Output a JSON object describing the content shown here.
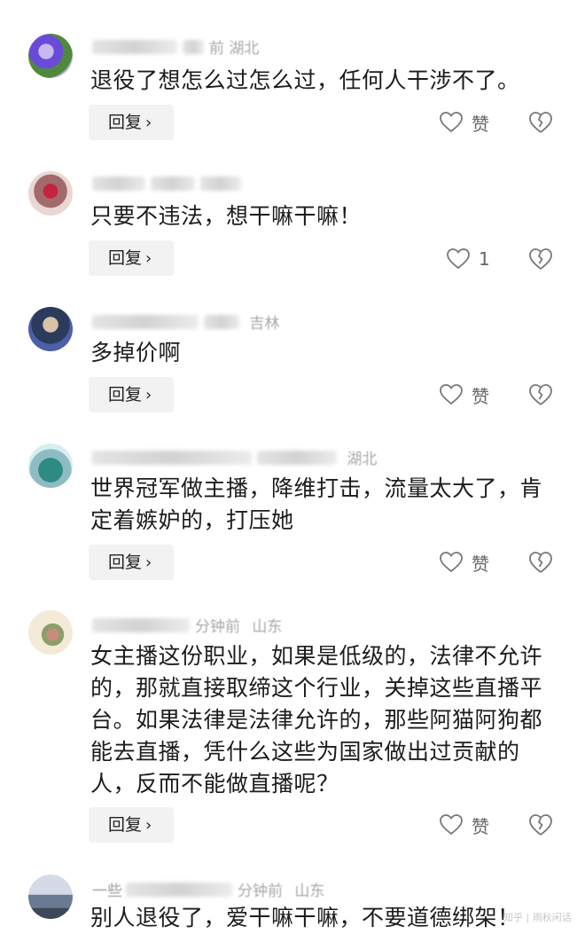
{
  "comments": [
    {
      "user": "",
      "time": "前",
      "region": "湖北",
      "text": "退役了想怎么过怎么过，任何人干涉不了。",
      "reply_label": "回复",
      "like_label": "赞",
      "avatar_colors": [
        "#6a4bd8",
        "#4f8a3c",
        "#c7b8ef"
      ]
    },
    {
      "user": "",
      "time": "",
      "region": "",
      "text": "只要不违法，想干嘛干嘛！",
      "reply_label": "回复",
      "like_label": "1",
      "avatar_colors": [
        "#a36a6d",
        "#c4243d",
        "#e8d7d2"
      ]
    },
    {
      "user": "",
      "time": "",
      "region": "吉林",
      "text": "多掉价啊",
      "reply_label": "回复",
      "like_label": "赞",
      "avatar_colors": [
        "#2c3b5c",
        "#d9c2a8",
        "#4c5fa8"
      ]
    },
    {
      "user": "",
      "time": "",
      "region": "湖北",
      "text": "世界冠军做主播，降维打击，流量太大了，肯定着嫉妒的，打压她",
      "reply_label": "回复",
      "like_label": "赞",
      "avatar_colors": [
        "#8fbcc4",
        "#2e8b83",
        "#d6eef0"
      ]
    },
    {
      "user": "",
      "time": "分钟前",
      "region": "山东",
      "text": "女主播这份职业，如果是低级的，法律不允许的，那就直接取缔这个行业，关掉这些直播平台。如果法律是法律允许的，那些阿猫阿狗都能去直播，凭什么这些为国家做出过贡献的人，反而不能做直播呢？",
      "reply_label": "回复",
      "like_label": "赞",
      "avatar_colors": [
        "#f3ead8",
        "#c78d7a",
        "#8aa06a"
      ]
    },
    {
      "user": "一些",
      "time": "分钟前",
      "region": "山东",
      "text": "别人退役了，爱干嘛干嘛，不要道德绑架！",
      "reply_label": "",
      "like_label": "",
      "avatar_colors": [
        "#6a7a92",
        "#d3dbe6",
        "#3d475a"
      ]
    }
  ],
  "icons": {
    "reply_chevron": "chevron-right-icon",
    "like": "heart-outline-icon",
    "dislike": "broken-heart-icon"
  },
  "watermark": "知乎 | 雨秋闲话"
}
